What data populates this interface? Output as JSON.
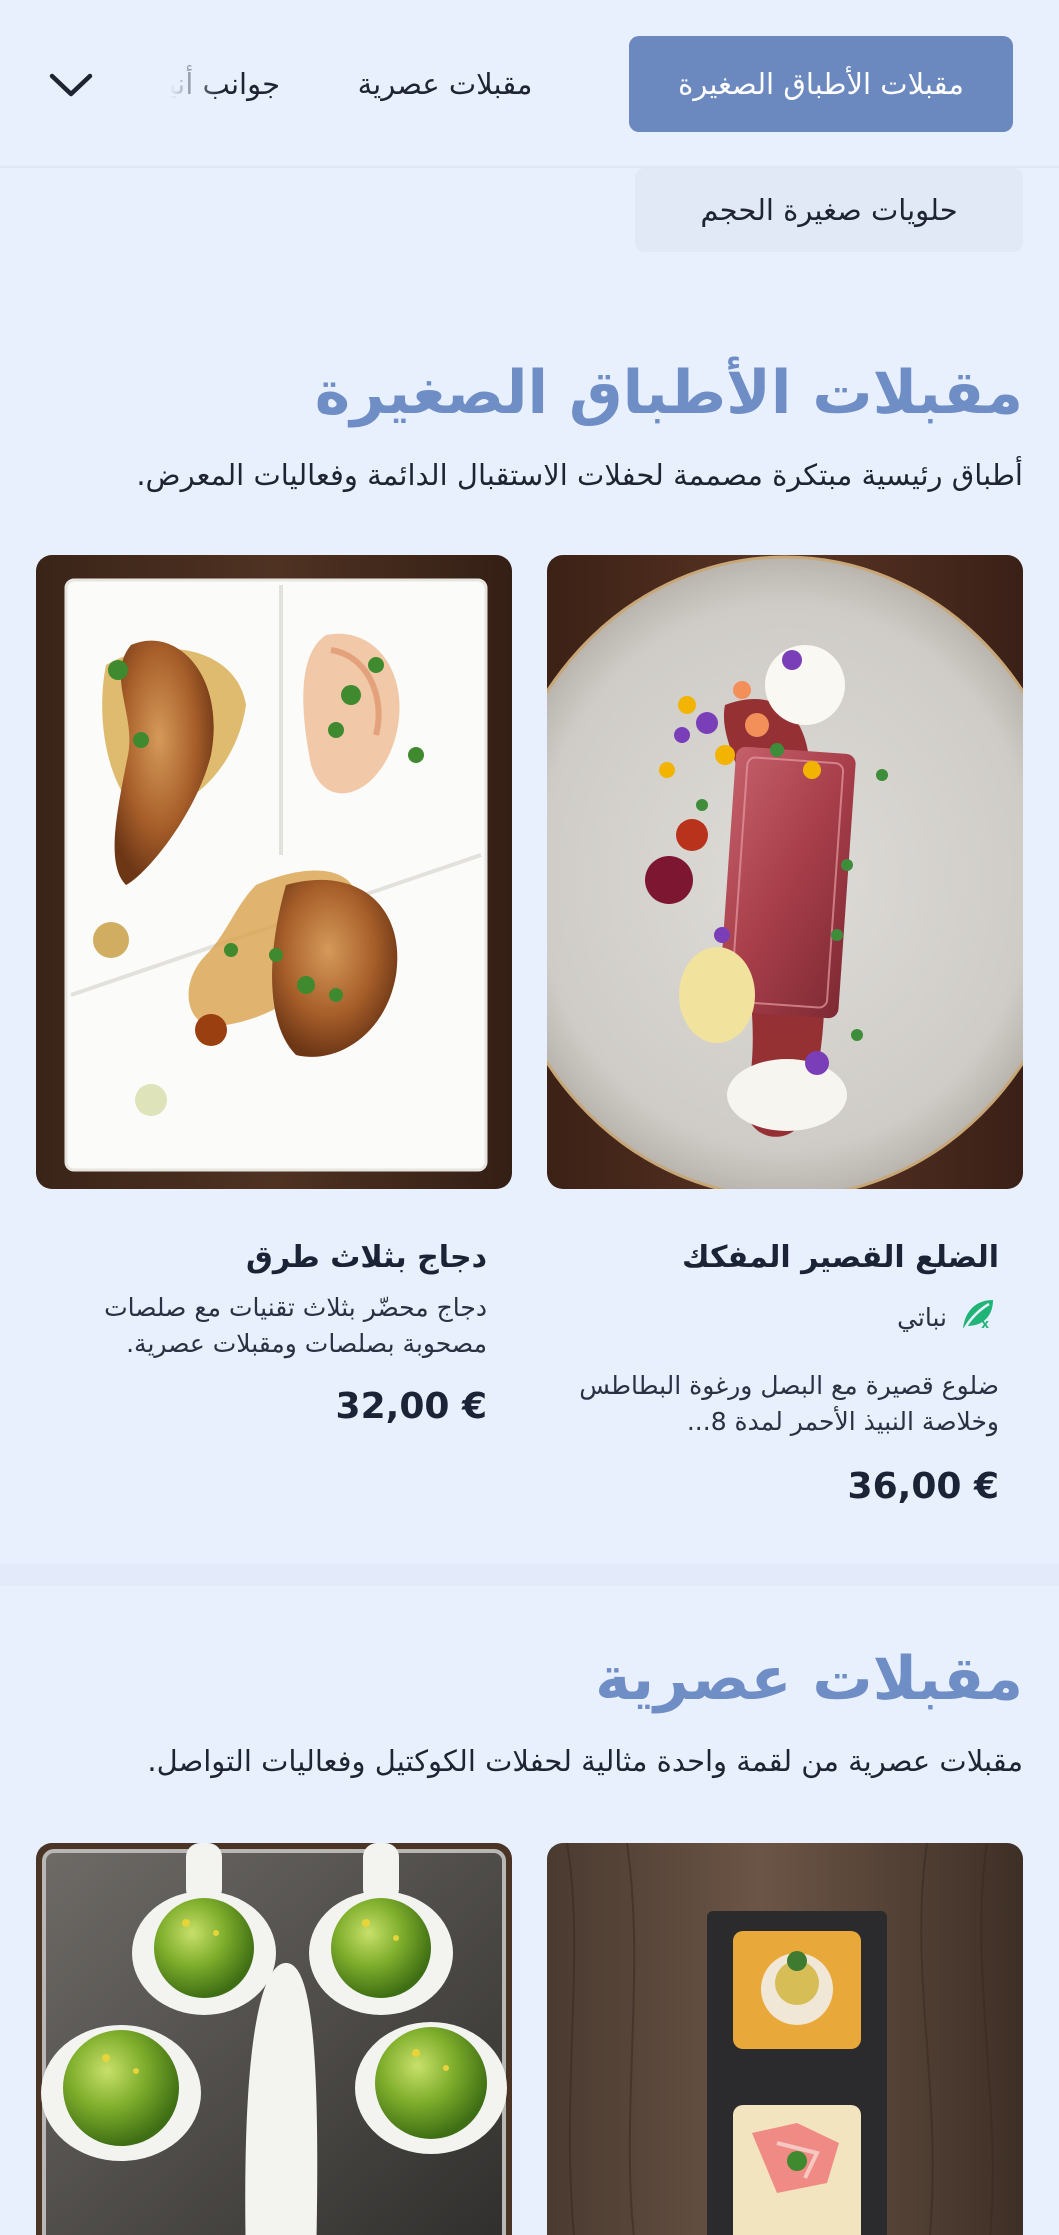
{
  "category_nav": {
    "items": [
      {
        "label": "مقبلات الأطباق الصغيرة",
        "active": true
      },
      {
        "label": "مقبلات عصرية",
        "active": false
      },
      {
        "label": "جوانب أنيقة",
        "active": false
      },
      {
        "label": "حلويات صغيرة الحجم",
        "active": false
      }
    ],
    "expand_icon": "chevron-down-icon"
  },
  "sections": [
    {
      "title": "مقبلات الأطباق الصغيرة",
      "subtitle": "أطباق رئيسية مبتكرة مصممة لحفلات الاستقبال الدائمة وفعاليات المعرض.",
      "items": [
        {
          "name": "الضلع القصير المفكك",
          "tag": {
            "icon": "vegan-leaf-icon",
            "label": "نباتي"
          },
          "description": "ضلوع قصيرة مع البصل ورغوة البطاطس وخلاصة النبيذ الأحمر لمدة 8...",
          "price": "36,00 €"
        },
        {
          "name": "دجاج بثلاث طرق",
          "description": "دجاج محضّر بثلاث تقنيات مع صلصات مصحوبة بصلصات ومقبلات عصرية.",
          "price": "32,00 €"
        }
      ]
    },
    {
      "title": "مقبلات عصرية",
      "subtitle": "مقبلات عصرية من لقمة واحدة مثالية لحفلات الكوكتيل وفعاليات التواصل."
    }
  ],
  "colors": {
    "background": "#e8effd",
    "accent": "#6b88bf",
    "section_title": "#6f8ec6",
    "vegan_icon": "#20b477"
  }
}
